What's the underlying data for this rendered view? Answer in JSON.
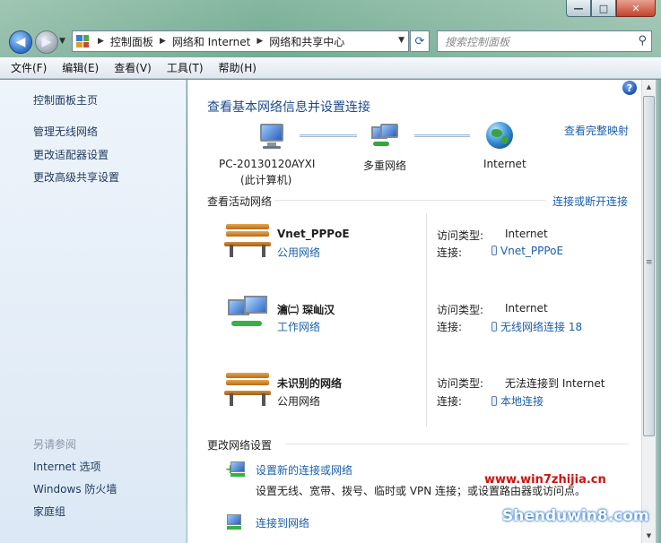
{
  "window": {
    "caption_buttons": {
      "minimize": "—",
      "maximize": "□",
      "close": "✕"
    }
  },
  "address_bar": {
    "breadcrumbs": [
      "控制面板",
      "网络和 Internet",
      "网络和共享中心"
    ],
    "search_placeholder": "搜索控制面板"
  },
  "menu": {
    "items": [
      "文件(F)",
      "编辑(E)",
      "查看(V)",
      "工具(T)",
      "帮助(H)"
    ]
  },
  "sidebar": {
    "home": "控制面板主页",
    "links": [
      "管理无线网络",
      "更改适配器设置",
      "更改高级共享设置"
    ],
    "see_also_title": "另请参阅",
    "see_also": [
      "Internet 选项",
      "Windows 防火墙",
      "家庭组"
    ]
  },
  "main": {
    "title": "查看基本网络信息并设置连接",
    "view_full_map": "查看完整映射",
    "map": {
      "computer_name": "PC-20130120AYXI",
      "computer_sub": "(此计算机)",
      "middle": "多重网络",
      "internet": "Internet"
    },
    "active_title": "查看活动网络",
    "connect_disconnect": "连接或断开连接",
    "access_label": "访问类型:",
    "conn_label": "连接:",
    "networks": [
      {
        "name": "Vnet_PPPoE",
        "type": "公用网络",
        "access": "Internet",
        "connection": "Vnet_PPPoE"
      },
      {
        "name": "瀹㈡   琛屾汉",
        "type": "工作网络",
        "access": "Internet",
        "connection": "无线网络连接 18"
      },
      {
        "name": "未识别的网络",
        "type": "公用网络",
        "access": "无法连接到 Internet",
        "connection": "本地连接"
      }
    ],
    "change_title": "更改网络设置",
    "tasks": [
      {
        "label": "设置新的连接或网络",
        "desc": "设置无线、宽带、拨号、临时或 VPN 连接；或设置路由器或访问点。"
      },
      {
        "label": "连接到网络",
        "desc": ""
      }
    ]
  },
  "watermark": {
    "url": "www.win7zhijia.cn",
    "brand": "Shenduwin8.com"
  },
  "colors": {
    "link": "#1b5faa",
    "heading": "#1c4a8a",
    "sidebar_link": "#1e395b",
    "sidebar_bg": "#e4edf7"
  }
}
